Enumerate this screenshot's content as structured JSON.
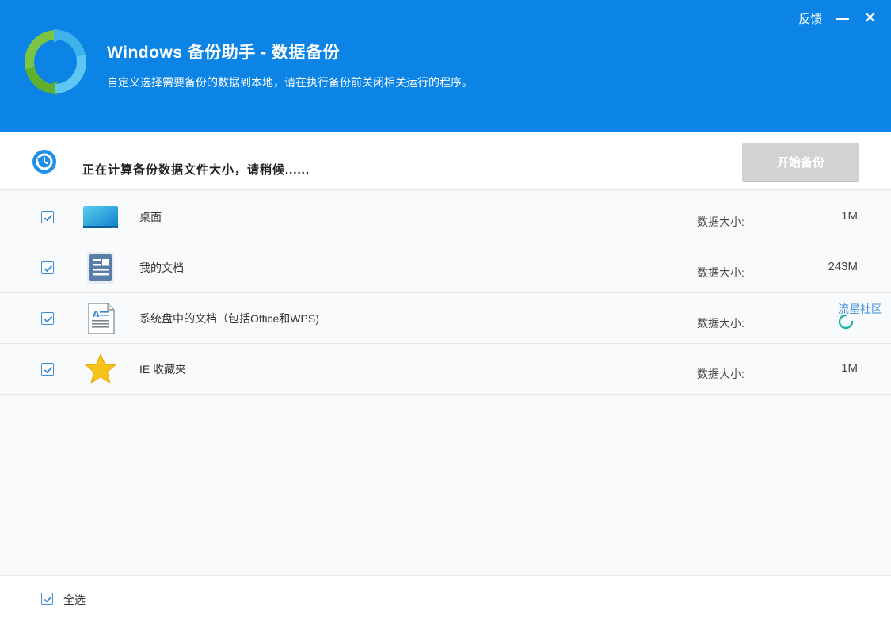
{
  "header": {
    "title": "Windows 备份助手 - 数据备份",
    "subtitle": "自定义选择需要备份的数据到本地，请在执行备份前关闭相关运行的程序。",
    "feedback_label": "反馈",
    "minimize_icon": "minimize-icon",
    "close_icon": "close-icon",
    "logo_icon": "sync-arrows-icon",
    "bg_color": "#0b84e6"
  },
  "status": {
    "text": "正在计算备份数据文件大小，请稍候......",
    "icon": "clock-refresh-icon",
    "start_button_label": "开始备份"
  },
  "items": [
    {
      "label": "桌面",
      "icon": "desktop-icon",
      "checked": true,
      "size_label": "数据大小:",
      "size_value": "1M"
    },
    {
      "label": "我的文档",
      "icon": "documents-icon",
      "checked": true,
      "size_label": "数据大小:",
      "size_value": "243M"
    },
    {
      "label": "系统盘中的文档（包括Office和WPS)",
      "icon": "text-document-icon",
      "checked": true,
      "size_label": "数据大小:",
      "size_value": "",
      "loading": true,
      "overlay_text": "流星社区"
    },
    {
      "label": "IE 收藏夹",
      "icon": "star-icon",
      "checked": true,
      "size_label": "数据大小:",
      "size_value": "1M"
    }
  ],
  "footer": {
    "select_all_label": "全选",
    "select_all_checked": true
  }
}
